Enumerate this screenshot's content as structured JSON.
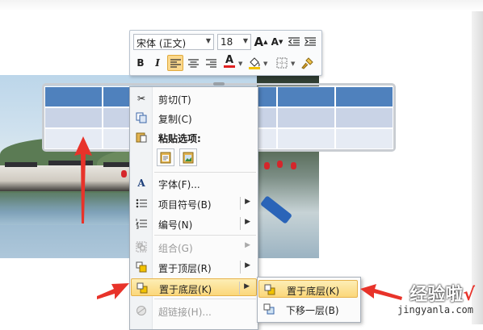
{
  "mini_toolbar": {
    "font_name": "宋体 (正文)",
    "font_size": "18",
    "grow_font": "A",
    "shrink_font": "A",
    "bold": "B",
    "italic": "I",
    "font_color_letter": "A"
  },
  "context_menu": {
    "items": [
      {
        "label": "剪切(T)",
        "icon": "scissors-icon"
      },
      {
        "label": "复制(C)",
        "icon": "copy-icon"
      },
      {
        "label": "粘贴选项:",
        "icon": "paste-icon"
      },
      {
        "label": "字体(F)...",
        "icon": "font-icon"
      },
      {
        "label": "项目符号(B)",
        "icon": "bullets-icon"
      },
      {
        "label": "编号(N)",
        "icon": "numbering-icon"
      },
      {
        "label": "组合(G)",
        "icon": "group-icon",
        "disabled": true
      },
      {
        "label": "置于顶层(R)",
        "icon": "bring-to-front-icon"
      },
      {
        "label": "置于底层(K)",
        "icon": "send-to-back-icon",
        "highlighted": true
      },
      {
        "label": "超链接(H)...",
        "icon": "hyperlink-icon",
        "disabled": true
      }
    ]
  },
  "submenu": {
    "items": [
      {
        "label": "置于底层(K)",
        "icon": "send-to-back-icon",
        "highlighted": true
      },
      {
        "label": "下移一层(B)",
        "icon": "send-backward-icon"
      }
    ]
  },
  "watermark": {
    "text": "经验啦",
    "check": "√",
    "url": "jingyanla.com"
  },
  "colors": {
    "table_header": "#4f81bd",
    "table_row_a": "#c9d3e6",
    "table_row_b": "#e6ebf4",
    "menu_highlight": "#fbd77a",
    "arrow_red": "#e8332a"
  }
}
